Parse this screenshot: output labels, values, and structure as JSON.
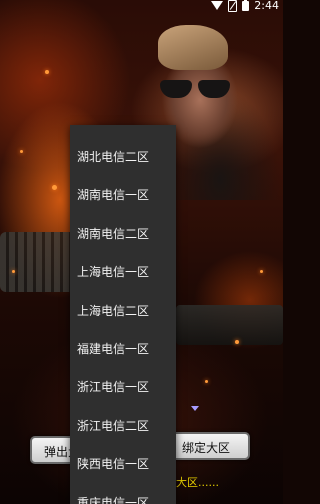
{
  "status_bar": {
    "time": "2:44"
  },
  "dropdown": {
    "items": [
      "湖北电信二区",
      "湖南电信一区",
      "湖南电信二区",
      "上海电信一区",
      "上海电信二区",
      "福建电信一区",
      "浙江电信一区",
      "浙江电信二区",
      "陕西电信一区",
      "重庆电信一区"
    ]
  },
  "buttons": {
    "popup_label": "弹出大",
    "bind_label": "绑定大区"
  },
  "footer": {
    "text": "大区......"
  },
  "colors": {
    "accent_footer": "#e8d000",
    "dropdown_bg": "#2f2f2f"
  },
  "icons": [
    "wifi-icon",
    "no-sim-icon",
    "battery-icon",
    "dropdown-arrow-icon"
  ]
}
